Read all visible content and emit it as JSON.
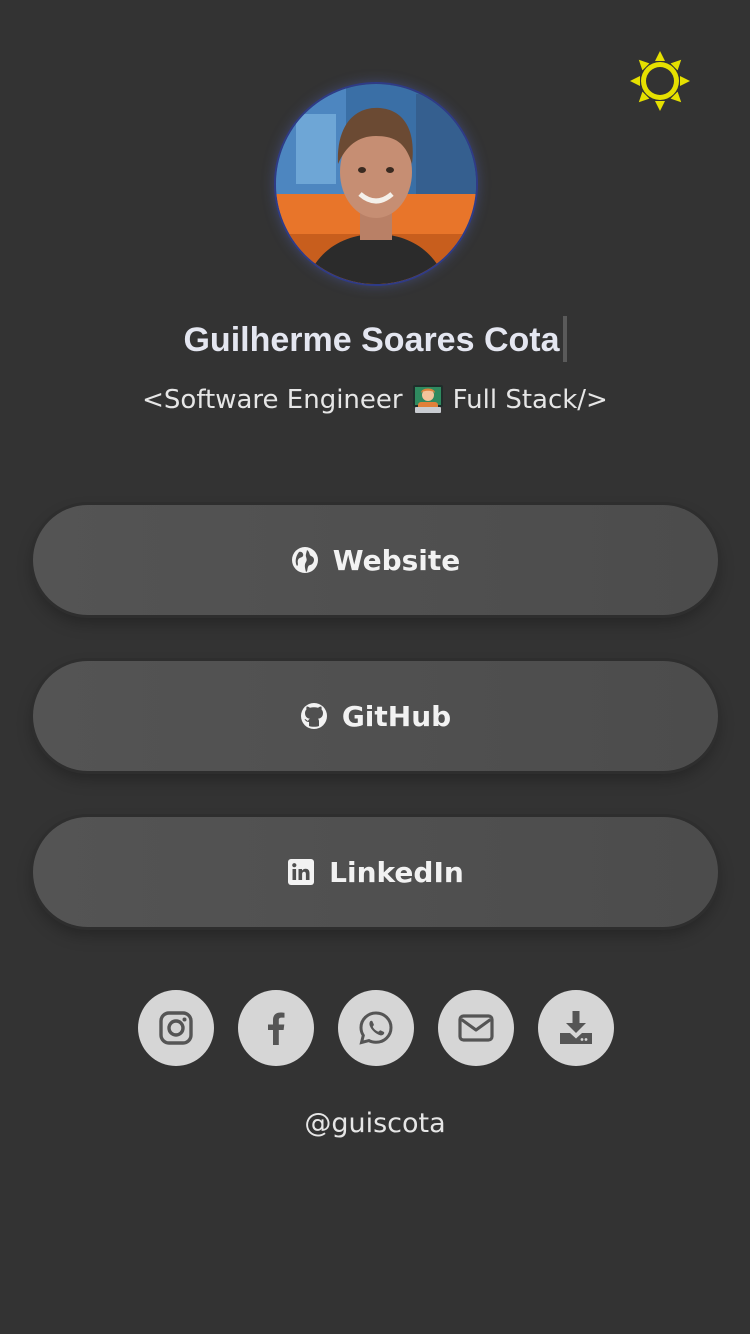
{
  "profile": {
    "name": "Guilherme Soares Cota",
    "role_before": "<Software Engineer",
    "role_after": "Full Stack/>",
    "emoji_icon": "technologist-emoji",
    "handle": "@guiscota"
  },
  "theme_toggle": {
    "icon": "sun-icon",
    "color": "#e5e000"
  },
  "links": [
    {
      "label": "Website",
      "icon": "globe-icon"
    },
    {
      "label": "GitHub",
      "icon": "github-icon"
    },
    {
      "label": "LinkedIn",
      "icon": "linkedin-icon"
    }
  ],
  "socials": [
    {
      "icon": "instagram-icon"
    },
    {
      "icon": "facebook-icon"
    },
    {
      "icon": "whatsapp-icon"
    },
    {
      "icon": "email-icon"
    },
    {
      "icon": "download-icon"
    }
  ],
  "colors": {
    "background": "#333333",
    "button": "#505050",
    "social_circle": "#d6d6d6",
    "social_icon": "#555555"
  }
}
